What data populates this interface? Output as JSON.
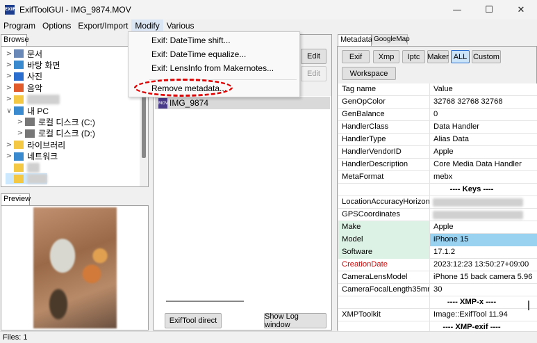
{
  "window": {
    "title": "ExifToolGUI - IMG_9874.MOV",
    "app_icon_text": "EXIF",
    "minimize": "—",
    "maximize": "☐",
    "close": "✕"
  },
  "menubar": {
    "items": [
      "Program",
      "Options",
      "Export/Import",
      "Modify",
      "Various"
    ]
  },
  "modify_menu": {
    "items": [
      "Exif: DateTime shift...",
      "Exif: DateTime equalize...",
      "Exif: LensInfo from Makernotes...",
      "Remove metadata..."
    ],
    "highlight_color": "#e00000"
  },
  "browse": {
    "tab_label": "Browse",
    "tree": [
      {
        "label": "문서",
        "icon": "documents-icon",
        "color": "#6a88b8"
      },
      {
        "label": "바탕 화면",
        "icon": "desktop-icon",
        "color": "#3a8ad0"
      },
      {
        "label": "사진",
        "icon": "pictures-icon",
        "color": "#2a6fd0"
      },
      {
        "label": "음악",
        "icon": "music-icon",
        "color": "#e05a2a"
      },
      {
        "label": "■■ ■■■■",
        "icon": "folder-icon",
        "color": "#f4c842"
      },
      {
        "label": "내 PC",
        "icon": "pc-icon",
        "color": "#3a8ad0"
      },
      {
        "label": "로컬 디스크 (C:)",
        "icon": "drive-c-icon",
        "color": "#777777"
      },
      {
        "label": "로컬 디스크 (D:)",
        "icon": "drive-d-icon",
        "color": "#777777"
      },
      {
        "label": "라이브러리",
        "icon": "folder-icon",
        "color": "#f4c842"
      },
      {
        "label": "네트워크",
        "icon": "network-icon",
        "color": "#3a8ad0"
      },
      {
        "label": "■ ■",
        "icon": "folder-icon",
        "color": "#f4c842"
      },
      {
        "label": "■■■■",
        "icon": "folder-icon",
        "color": "#f4c842"
      }
    ]
  },
  "preview": {
    "tab_label": "Preview"
  },
  "middle": {
    "edit_button": "Edit",
    "edit_button_disabled": "Edit",
    "file_name": "IMG_9874",
    "mov_icon_text": "MOV",
    "exiftool_direct": "ExifTool direct",
    "show_log": "Show Log window"
  },
  "metadata": {
    "tab_label": "Metadata",
    "googlemap_tab": "GoogleMap",
    "buttons": [
      "Exif",
      "Xmp",
      "Iptc",
      "Maker",
      "ALL",
      "Custom"
    ],
    "active_button": "ALL",
    "workspace_button": "Workspace",
    "header": {
      "name": "Tag name",
      "value": "Value"
    },
    "rows": [
      {
        "name": "GenOpColor",
        "value": "32768 32768 32768",
        "style": ""
      },
      {
        "name": "GenBalance",
        "value": "0",
        "style": ""
      },
      {
        "name": "HandlerClass",
        "value": "Data Handler",
        "style": ""
      },
      {
        "name": "HandlerType",
        "value": "Alias Data",
        "style": ""
      },
      {
        "name": "HandlerVendorID",
        "value": "Apple",
        "style": ""
      },
      {
        "name": "HandlerDescription",
        "value": "Core Media Data Handler",
        "style": ""
      },
      {
        "name": "MetaFormat",
        "value": "mebx",
        "style": ""
      },
      {
        "name": "",
        "value": "---- Keys ----",
        "style": "section"
      },
      {
        "name": "LocationAccuracyHorizont",
        "value": "■■ ■■■■",
        "style": "blur"
      },
      {
        "name": "GPSCoordinates",
        "value": "■■ ■■■■■ ■■ ■■■ ■■■■■",
        "style": "blur"
      },
      {
        "name": "Make",
        "value": "Apple",
        "style": "green"
      },
      {
        "name": "Model",
        "value": "iPhone 15",
        "style": "sel"
      },
      {
        "name": "Software",
        "value": "17.1.2",
        "style": "green"
      },
      {
        "name": "CreationDate",
        "value": "2023:12:23 13:50:27+09:00",
        "style": "red"
      },
      {
        "name": "CameraLensModel",
        "value": "iPhone 15 back camera 5.96",
        "style": ""
      },
      {
        "name": "CameraFocalLength35mm",
        "value": "30",
        "style": ""
      },
      {
        "name": "",
        "value": "---- XMP-x ----",
        "style": "section"
      },
      {
        "name": "XMPToolkit",
        "value": "Image::ExifTool 11.94",
        "style": ""
      },
      {
        "name": "",
        "value": "---- XMP-exif ----",
        "style": "section"
      }
    ]
  },
  "statusbar": {
    "text": "Files: 1"
  }
}
